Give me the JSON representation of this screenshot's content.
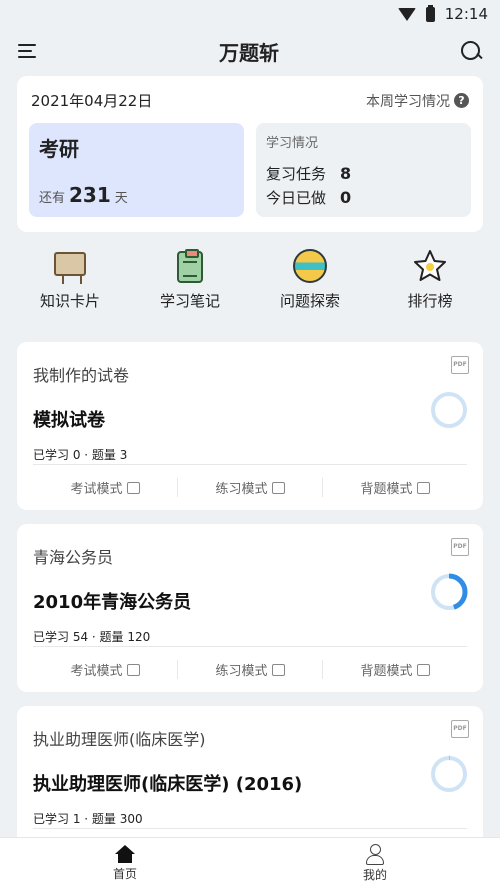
{
  "status": {
    "time": "12:14"
  },
  "app": {
    "title": "万题斩"
  },
  "summary": {
    "date": "2021年04月22日",
    "weekly_link": "本周学习情况",
    "exam_name": "考研",
    "countdown_prefix": "还有",
    "countdown_days": "231",
    "countdown_suffix": "天",
    "study_title": "学习情况",
    "review_label": "复习任务",
    "review_value": "8",
    "today_label": "今日已做",
    "today_value": "0"
  },
  "quick": [
    {
      "label": "知识卡片",
      "icon": "presentation-board-icon"
    },
    {
      "label": "学习笔记",
      "icon": "clipboard-notes-icon"
    },
    {
      "label": "问题探索",
      "icon": "striped-ball-icon"
    },
    {
      "label": "排行榜",
      "icon": "star-icon"
    }
  ],
  "papers": [
    {
      "category": "我制作的试卷",
      "title": "模拟试卷",
      "meta": "已学习 0 · 题量 3",
      "progress": 0.0
    },
    {
      "category": "青海公务员",
      "title": "2010年青海公务员",
      "meta": "已学习 54 · 题量 120",
      "progress": 0.45
    },
    {
      "category": "执业助理医师(临床医学)",
      "title": "执业助理医师(临床医学) (2016)",
      "meta": "已学习 1 · 题量 300",
      "progress": 0.0033
    }
  ],
  "modes": {
    "exam": "考试模式",
    "practice": "练习模式",
    "recite": "背题模式"
  },
  "pdf_label": "PDF",
  "nav": {
    "home": "首页",
    "mine": "我的"
  },
  "colors": {
    "accent": "#2f8de4",
    "ring_track": "#cfe3f5",
    "exam_box": "#dde6fc"
  }
}
